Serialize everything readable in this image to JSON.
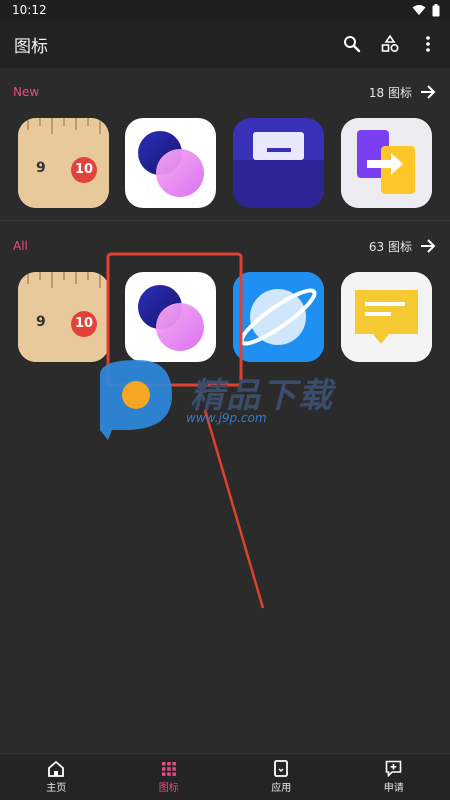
{
  "status_bar": {
    "time": "10:12"
  },
  "app_bar": {
    "title": "图标"
  },
  "sections": {
    "new": {
      "label": "New",
      "count": "18 图标",
      "label_color": "#e84a86"
    },
    "all": {
      "label": "All",
      "count": "63 图标",
      "label_color": "#e84a86"
    }
  },
  "icons_new": [
    "ruler-app-icon",
    "circles-app-icon",
    "inbox-app-icon",
    "transfer-app-icon"
  ],
  "icons_all": [
    "ruler-app-icon",
    "circles-app-icon",
    "planet-browser-icon",
    "message-app-icon"
  ],
  "ruler": {
    "num_left": "9",
    "num_right": "10"
  },
  "watermark": {
    "text": "精品下载",
    "url": "www.j9p.com"
  },
  "bottom_nav": {
    "items": [
      {
        "label": "主页",
        "icon": "home-icon"
      },
      {
        "label": "图标",
        "icon": "grid-icon",
        "active": true
      },
      {
        "label": "应用",
        "icon": "device-icon"
      },
      {
        "label": "申请",
        "icon": "add-box-icon"
      }
    ]
  },
  "colors": {
    "accent": "#e84a86",
    "highlight_box": "#e0422f",
    "background": "#2b2b2b"
  }
}
